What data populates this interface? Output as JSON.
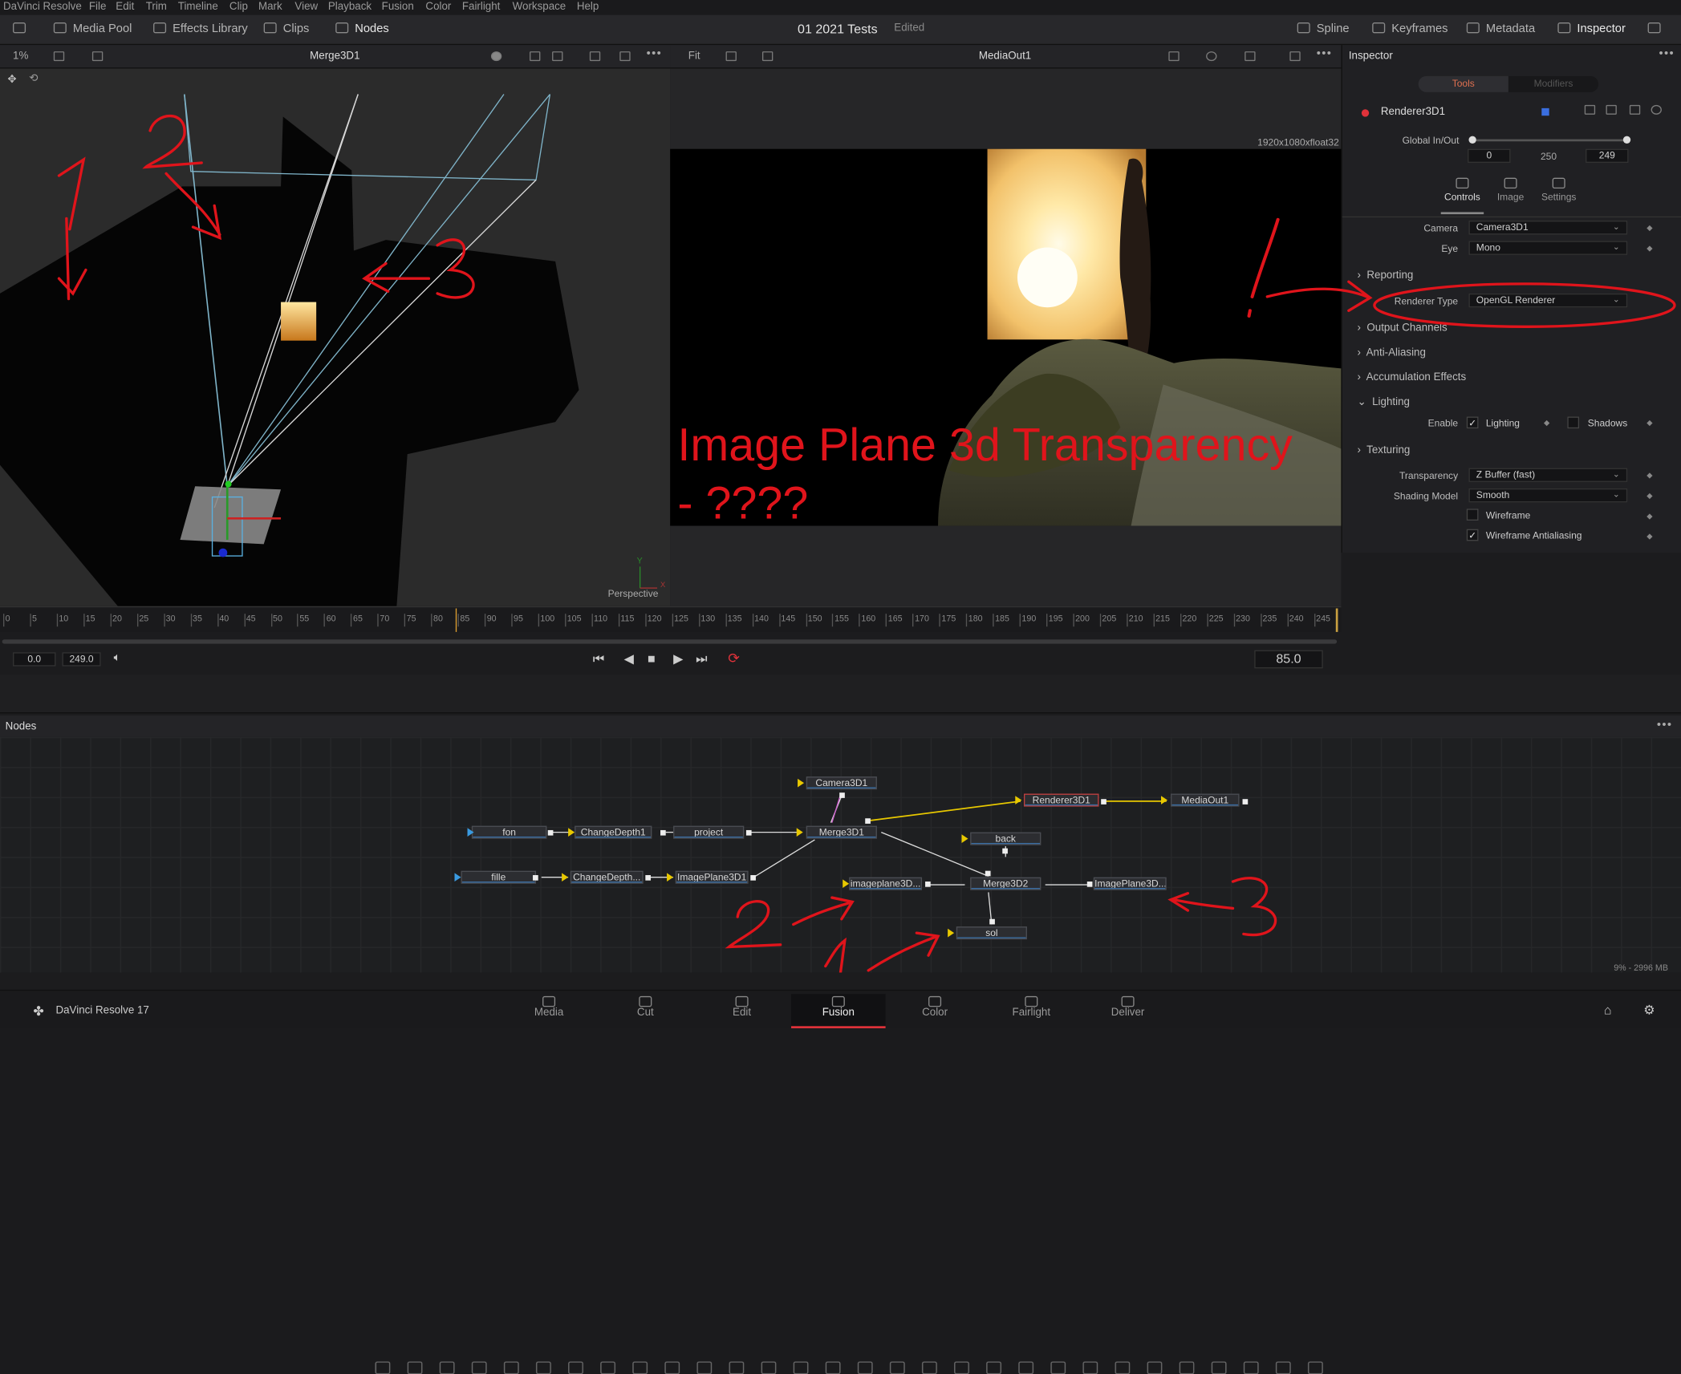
{
  "menubar": [
    "DaVinci Resolve",
    "File",
    "Edit",
    "Trim",
    "Timeline",
    "Clip",
    "Mark",
    "View",
    "Playback",
    "Fusion",
    "Color",
    "Fairlight",
    "Workspace",
    "Help"
  ],
  "toolbar": {
    "media_pool": "Media Pool",
    "effects_library": "Effects Library",
    "clips": "Clips",
    "nodes": "Nodes",
    "project_title": "01 2021 Tests",
    "status": "Edited",
    "spline": "Spline",
    "keyframes": "Keyframes",
    "metadata": "Metadata",
    "inspector": "Inspector"
  },
  "viewer_left": {
    "zoom": "1%",
    "title": "Merge3D1",
    "view_label": "Perspective",
    "axis_y": "Y",
    "axis_x": "X"
  },
  "viewer_right": {
    "fit": "Fit",
    "title": "MediaOut1",
    "resolution": "1920x1080xfloat32"
  },
  "inspector": {
    "title": "Inspector",
    "tabs": [
      "Tools",
      "Modifiers"
    ],
    "tool_name": "Renderer3D1",
    "global_inout_label": "Global In/Out",
    "global_in": "0",
    "global_mid": "250",
    "global_out": "249",
    "subtabs": [
      "Controls",
      "Image",
      "Settings"
    ],
    "camera_label": "Camera",
    "camera_value": "Camera3D1",
    "eye_label": "Eye",
    "eye_value": "Mono",
    "reporting": "Reporting",
    "renderer_type_label": "Renderer Type",
    "renderer_type_value": "OpenGL Renderer",
    "output_channels": "Output Channels",
    "anti_aliasing": "Anti-Aliasing",
    "accumulation_effects": "Accumulation Effects",
    "lighting": "Lighting",
    "enable_label": "Enable",
    "lighting_check": "Lighting",
    "shadows_check": "Shadows",
    "texturing": "Texturing",
    "transparency_label": "Transparency",
    "transparency_value": "Z Buffer (fast)",
    "shading_model_label": "Shading Model",
    "shading_model_value": "Smooth",
    "wireframe": "Wireframe",
    "wireframe_aa": "Wireframe Antialiasing"
  },
  "ruler": [
    "0",
    "5",
    "10",
    "15",
    "20",
    "25",
    "30",
    "35",
    "40",
    "45",
    "50",
    "55",
    "60",
    "65",
    "70",
    "75",
    "80",
    "85",
    "90",
    "95",
    "100",
    "105",
    "110",
    "115",
    "120",
    "125",
    "130",
    "135",
    "140",
    "145",
    "150",
    "155",
    "160",
    "165",
    "170",
    "175",
    "180",
    "185",
    "190",
    "195",
    "200",
    "205",
    "210",
    "215",
    "220",
    "225",
    "230",
    "235",
    "240",
    "245"
  ],
  "transport": {
    "start": "0.0",
    "end": "249.0",
    "current": "85.0"
  },
  "nodes_panel": {
    "title": "Nodes",
    "items": {
      "camera": "Camera3D1",
      "renderer": "Renderer3D1",
      "mediaout": "MediaOut1",
      "fon": "fon",
      "changedepth1": "ChangeDepth1",
      "project": "project",
      "merge3d1": "Merge3D1",
      "back": "back",
      "fille": "fille",
      "changedepth2": "ChangeDepth...",
      "imageplane3d1": "ImagePlane3D1",
      "imageplane3d_a": "imageplane3D...",
      "merge3d2": "Merge3D2",
      "imageplane3d_b": "ImagePlane3D...",
      "sol": "sol"
    },
    "memory": "9% - 2996 MB"
  },
  "bottom_bar": {
    "app": "DaVinci Resolve 17",
    "pages": [
      "Media",
      "Cut",
      "Edit",
      "Fusion",
      "Color",
      "Fairlight",
      "Deliver"
    ]
  },
  "annotations": {
    "caption_line1": "Image Plane 3d Transparency",
    "caption_line2": "- ????",
    "marks_left": [
      "1",
      "2",
      "3"
    ],
    "mark_inspector": "!",
    "marks_nodes": [
      "2",
      "1",
      "3"
    ]
  },
  "colors": {
    "accent_red": "#e0141b",
    "node_blue": "#3a6ea5",
    "link_yellow": "#e8c800"
  }
}
